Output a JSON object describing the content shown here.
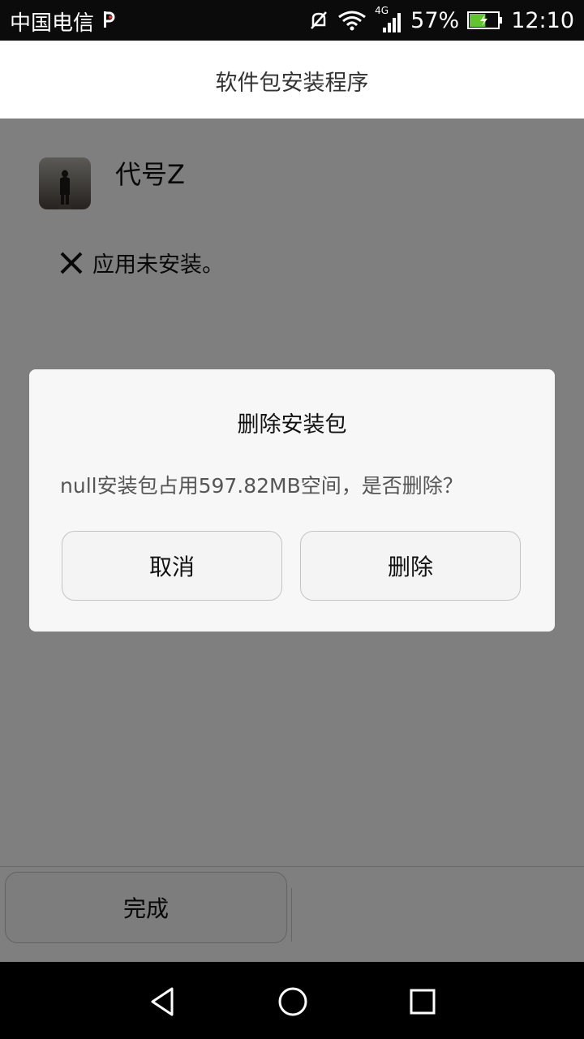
{
  "status_bar": {
    "carrier": "中国电信",
    "network": "4G",
    "battery": "57%",
    "battery_level": 0.57,
    "time": "12:10",
    "icons": [
      "p-icon",
      "mute-icon",
      "wifi-icon",
      "signal-icon",
      "battery-icon"
    ]
  },
  "header": {
    "title": "软件包安装程序"
  },
  "app": {
    "name": "代号Z",
    "icon": "app-icon"
  },
  "result": {
    "icon": "close-icon",
    "text": "应用未安装。"
  },
  "footer": {
    "done_label": "完成"
  },
  "dialog": {
    "title": "删除安装包",
    "message": "null安装包占用597.82MB空间，是否删除？",
    "cancel_label": "取消",
    "delete_label": "删除"
  },
  "navbar": {
    "icons": [
      "back-icon",
      "home-icon",
      "recents-icon"
    ]
  },
  "colors": {
    "scrim": "rgba(0,0,0,0.5)",
    "dialog_bg": "#f7f7f7",
    "battery": "#63c432"
  }
}
